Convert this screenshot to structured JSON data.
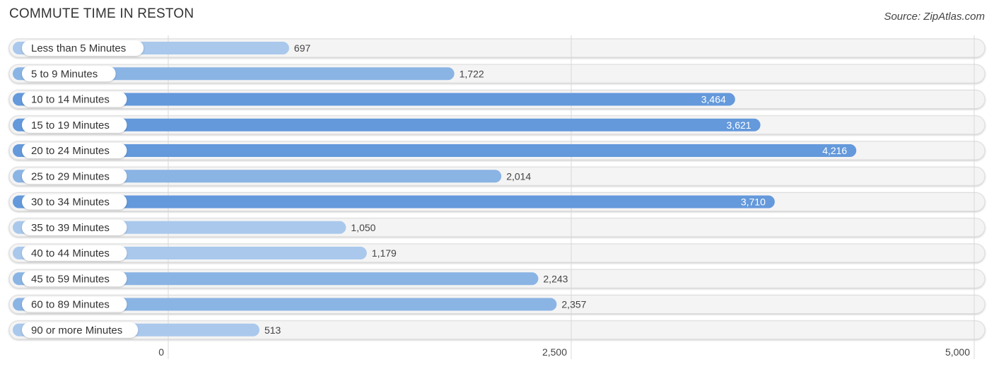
{
  "header": {
    "title": "COMMUTE TIME IN RESTON",
    "source": "Source: ZipAtlas.com"
  },
  "chart_data": {
    "type": "bar",
    "orientation": "horizontal",
    "title": "COMMUTE TIME IN RESTON",
    "xlabel": "",
    "ylabel": "",
    "categories": [
      "Less than 5 Minutes",
      "5 to 9 Minutes",
      "10 to 14 Minutes",
      "15 to 19 Minutes",
      "20 to 24 Minutes",
      "25 to 29 Minutes",
      "30 to 34 Minutes",
      "35 to 39 Minutes",
      "40 to 44 Minutes",
      "45 to 59 Minutes",
      "60 to 89 Minutes",
      "90 or more Minutes"
    ],
    "values": [
      697,
      1722,
      3464,
      3621,
      4216,
      2014,
      3710,
      1050,
      1179,
      2243,
      2357,
      513
    ],
    "value_labels": [
      "697",
      "1,722",
      "3,464",
      "3,621",
      "4,216",
      "2,014",
      "3,710",
      "1,050",
      "1,179",
      "2,243",
      "2,357",
      "513"
    ],
    "xlim": [
      0,
      5000
    ],
    "xticks": [
      0,
      2500,
      5000
    ],
    "xtick_labels": [
      "0",
      "2,500",
      "5,000"
    ],
    "grid": true,
    "legend": "none",
    "colors": {
      "bar_strong": "#6499db",
      "bar_light": "#a9c8ec",
      "track": "#f4f4f4",
      "grid": "#d9d9d9"
    }
  }
}
